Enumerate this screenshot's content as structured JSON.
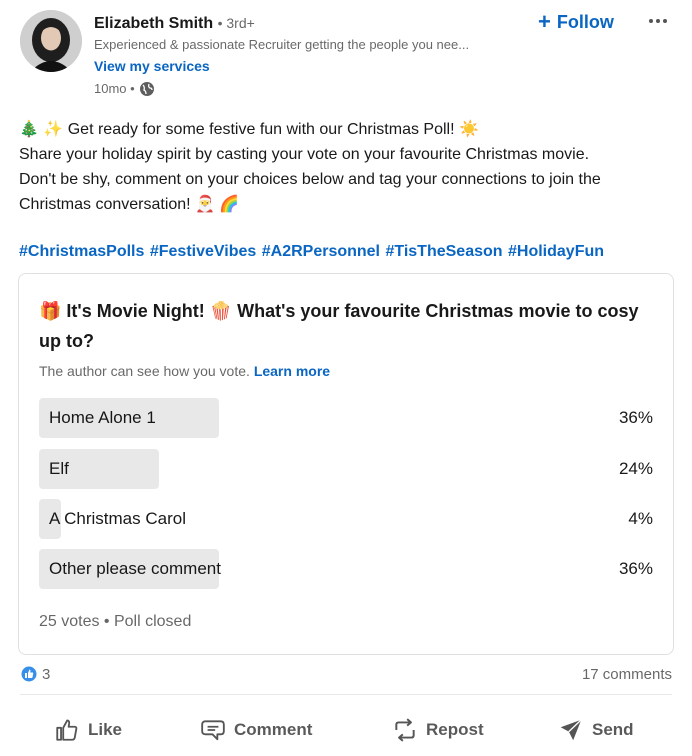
{
  "author": {
    "name": "Elizabeth Smith",
    "degree": "• 3rd+",
    "headline": "Experienced & passionate Recruiter getting the people you nee...",
    "services_link": "View my services",
    "timestamp": "10mo •",
    "visibility_icon": "globe-icon"
  },
  "header_actions": {
    "follow_label": "Follow",
    "follow_icon": "plus-icon",
    "more_icon": "ellipsis-icon"
  },
  "post": {
    "line1": "🎄 ✨ Get ready for some festive fun with our Christmas Poll! ☀️",
    "line2": "Share your holiday spirit by casting your vote on your favourite Christmas movie.",
    "line3": "Don't be shy, comment on your choices below and tag your connections to join the",
    "line4": "Christmas conversation! 🎅 🌈",
    "hashtags": [
      "#ChristmasPolls",
      "#FestiveVibes",
      "#A2RPersonnel",
      "#TisTheSeason",
      "#HolidayFun"
    ]
  },
  "poll": {
    "question": "🎁 It's Movie Night! 🍿 What's your favourite Christmas movie to cosy up to?",
    "note": "The author can see how you vote.",
    "learn_more": "Learn more",
    "options": [
      {
        "label": "Home Alone 1",
        "percent_label": "36%",
        "percent": 36
      },
      {
        "label": "Elf",
        "percent_label": "24%",
        "percent": 24
      },
      {
        "label": "A Christmas Carol",
        "percent_label": "4%",
        "percent": 4
      },
      {
        "label": "Other please comment",
        "percent_label": "36%",
        "percent": 36
      }
    ],
    "footer": "25 votes • Poll closed"
  },
  "social": {
    "reaction_icon": "like-reaction-icon",
    "reaction_count": "3",
    "comments": "17 comments"
  },
  "actions": {
    "like": "Like",
    "comment": "Comment",
    "repost": "Repost",
    "send": "Send"
  },
  "colors": {
    "link_blue": "#0a66c2",
    "bar_gray": "#e8e8e8"
  }
}
